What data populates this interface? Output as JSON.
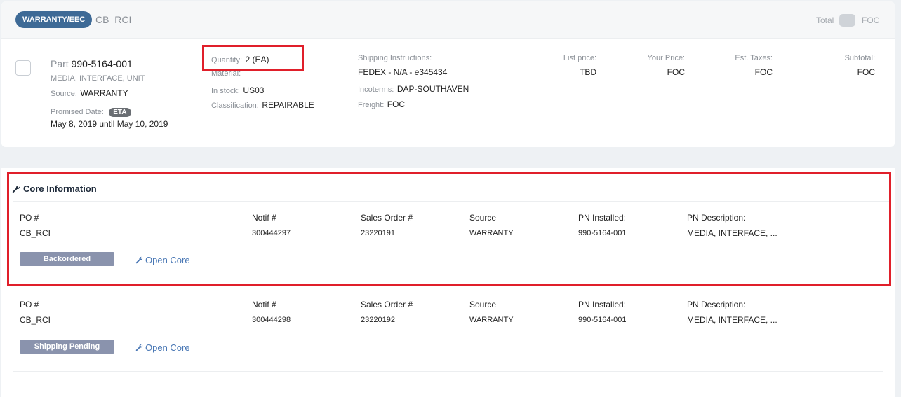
{
  "header": {
    "badge": "WARRANTY/EEC",
    "order_id": "CB_RCI",
    "total_label": "Total",
    "foc_label": "FOC"
  },
  "part": {
    "part_prefix": "Part",
    "part_number": "990-5164-001",
    "description": "MEDIA, INTERFACE, UNIT",
    "source_label": "Source:",
    "source_value": "WARRANTY",
    "promised_label": "Promised Date:",
    "eta_badge": "ETA",
    "promised_value": "May 8, 2019 until May 10, 2019"
  },
  "details": {
    "quantity_label": "Quantity:",
    "quantity_value": "2 (EA)",
    "material_label": "Material:",
    "stock_label": "In stock:",
    "stock_value": "US03",
    "class_label": "Classification:",
    "class_value": "REPAIRABLE"
  },
  "shipping": {
    "instructions_label": "Shipping Instructions:",
    "instructions_value": "FEDEX - N/A - e345434",
    "incoterms_label": "Incoterms:",
    "incoterms_value": "DAP-SOUTHAVEN",
    "freight_label": "Freight:",
    "freight_value": "FOC"
  },
  "pricing": {
    "list_label": "List price:",
    "list_value": "TBD",
    "your_label": "Your Price:",
    "your_value": "FOC",
    "tax_label": "Est. Taxes:",
    "tax_value": "FOC",
    "subtotal_label": "Subtotal:",
    "subtotal_value": "FOC"
  },
  "core": {
    "title": "Core Information",
    "columns": [
      "PO #",
      "Notif #",
      "Sales Order #",
      "Source",
      "PN Installed:",
      "PN Description:"
    ],
    "open_core_label": "Open Core",
    "rows": [
      {
        "po": "CB_RCI",
        "notif": "300444297",
        "sales_order": "23220191",
        "source": "WARRANTY",
        "pn_installed": "990-5164-001",
        "pn_description": "MEDIA, INTERFACE, ...",
        "status": "Backordered"
      },
      {
        "po": "CB_RCI",
        "notif": "300444298",
        "sales_order": "23220192",
        "source": "WARRANTY",
        "pn_installed": "990-5164-001",
        "pn_description": "MEDIA, INTERFACE, ...",
        "status": "Shipping Pending"
      }
    ]
  },
  "colors": {
    "badge_bg": "#3e6a96",
    "status_bg": "#8a93ad",
    "link": "#4a78b5",
    "highlight": "#e01f2a"
  }
}
